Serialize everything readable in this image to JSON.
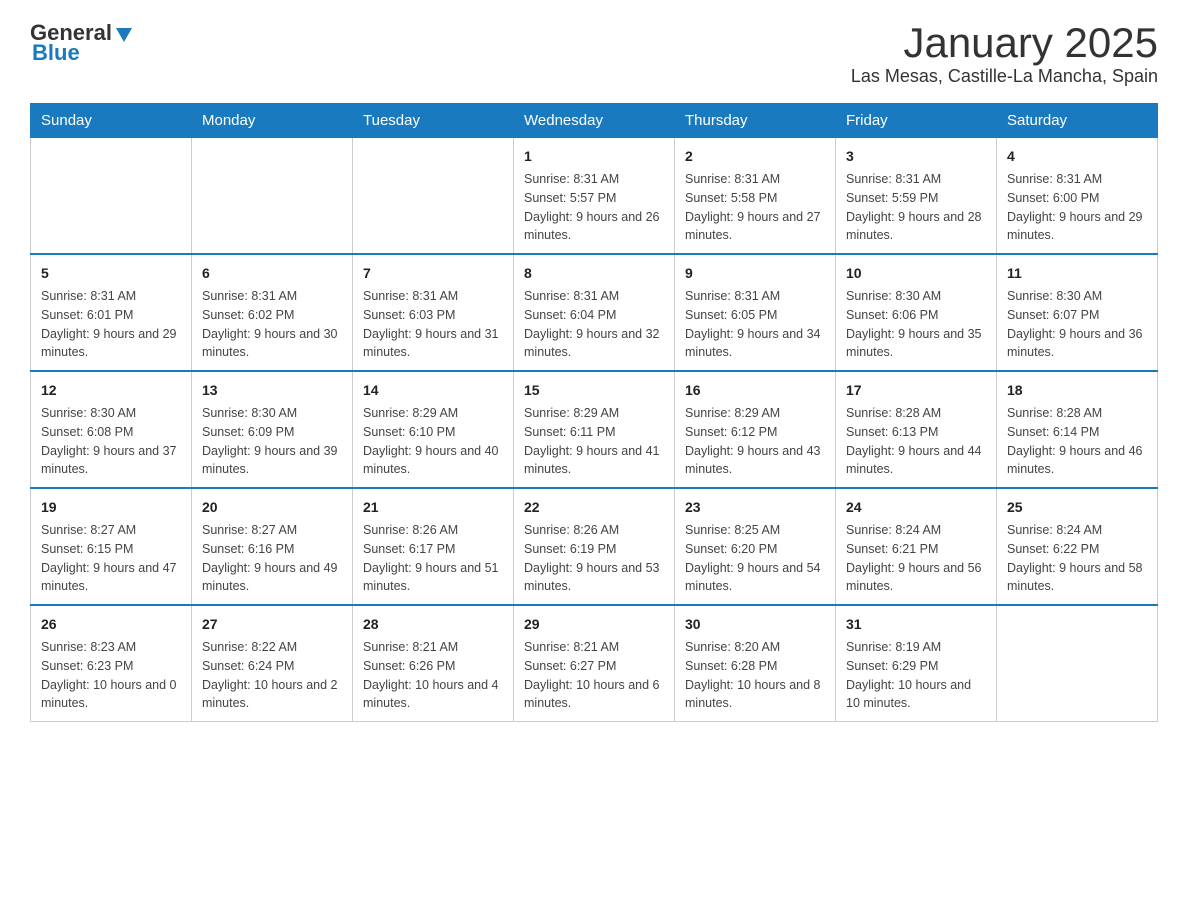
{
  "header": {
    "logo_general": "General",
    "logo_blue": "Blue",
    "title": "January 2025",
    "location": "Las Mesas, Castille-La Mancha, Spain"
  },
  "days_of_week": [
    "Sunday",
    "Monday",
    "Tuesday",
    "Wednesday",
    "Thursday",
    "Friday",
    "Saturday"
  ],
  "weeks": [
    {
      "days": [
        {
          "number": "",
          "info": ""
        },
        {
          "number": "",
          "info": ""
        },
        {
          "number": "",
          "info": ""
        },
        {
          "number": "1",
          "info": "Sunrise: 8:31 AM\nSunset: 5:57 PM\nDaylight: 9 hours and 26 minutes."
        },
        {
          "number": "2",
          "info": "Sunrise: 8:31 AM\nSunset: 5:58 PM\nDaylight: 9 hours and 27 minutes."
        },
        {
          "number": "3",
          "info": "Sunrise: 8:31 AM\nSunset: 5:59 PM\nDaylight: 9 hours and 28 minutes."
        },
        {
          "number": "4",
          "info": "Sunrise: 8:31 AM\nSunset: 6:00 PM\nDaylight: 9 hours and 29 minutes."
        }
      ]
    },
    {
      "days": [
        {
          "number": "5",
          "info": "Sunrise: 8:31 AM\nSunset: 6:01 PM\nDaylight: 9 hours and 29 minutes."
        },
        {
          "number": "6",
          "info": "Sunrise: 8:31 AM\nSunset: 6:02 PM\nDaylight: 9 hours and 30 minutes."
        },
        {
          "number": "7",
          "info": "Sunrise: 8:31 AM\nSunset: 6:03 PM\nDaylight: 9 hours and 31 minutes."
        },
        {
          "number": "8",
          "info": "Sunrise: 8:31 AM\nSunset: 6:04 PM\nDaylight: 9 hours and 32 minutes."
        },
        {
          "number": "9",
          "info": "Sunrise: 8:31 AM\nSunset: 6:05 PM\nDaylight: 9 hours and 34 minutes."
        },
        {
          "number": "10",
          "info": "Sunrise: 8:30 AM\nSunset: 6:06 PM\nDaylight: 9 hours and 35 minutes."
        },
        {
          "number": "11",
          "info": "Sunrise: 8:30 AM\nSunset: 6:07 PM\nDaylight: 9 hours and 36 minutes."
        }
      ]
    },
    {
      "days": [
        {
          "number": "12",
          "info": "Sunrise: 8:30 AM\nSunset: 6:08 PM\nDaylight: 9 hours and 37 minutes."
        },
        {
          "number": "13",
          "info": "Sunrise: 8:30 AM\nSunset: 6:09 PM\nDaylight: 9 hours and 39 minutes."
        },
        {
          "number": "14",
          "info": "Sunrise: 8:29 AM\nSunset: 6:10 PM\nDaylight: 9 hours and 40 minutes."
        },
        {
          "number": "15",
          "info": "Sunrise: 8:29 AM\nSunset: 6:11 PM\nDaylight: 9 hours and 41 minutes."
        },
        {
          "number": "16",
          "info": "Sunrise: 8:29 AM\nSunset: 6:12 PM\nDaylight: 9 hours and 43 minutes."
        },
        {
          "number": "17",
          "info": "Sunrise: 8:28 AM\nSunset: 6:13 PM\nDaylight: 9 hours and 44 minutes."
        },
        {
          "number": "18",
          "info": "Sunrise: 8:28 AM\nSunset: 6:14 PM\nDaylight: 9 hours and 46 minutes."
        }
      ]
    },
    {
      "days": [
        {
          "number": "19",
          "info": "Sunrise: 8:27 AM\nSunset: 6:15 PM\nDaylight: 9 hours and 47 minutes."
        },
        {
          "number": "20",
          "info": "Sunrise: 8:27 AM\nSunset: 6:16 PM\nDaylight: 9 hours and 49 minutes."
        },
        {
          "number": "21",
          "info": "Sunrise: 8:26 AM\nSunset: 6:17 PM\nDaylight: 9 hours and 51 minutes."
        },
        {
          "number": "22",
          "info": "Sunrise: 8:26 AM\nSunset: 6:19 PM\nDaylight: 9 hours and 53 minutes."
        },
        {
          "number": "23",
          "info": "Sunrise: 8:25 AM\nSunset: 6:20 PM\nDaylight: 9 hours and 54 minutes."
        },
        {
          "number": "24",
          "info": "Sunrise: 8:24 AM\nSunset: 6:21 PM\nDaylight: 9 hours and 56 minutes."
        },
        {
          "number": "25",
          "info": "Sunrise: 8:24 AM\nSunset: 6:22 PM\nDaylight: 9 hours and 58 minutes."
        }
      ]
    },
    {
      "days": [
        {
          "number": "26",
          "info": "Sunrise: 8:23 AM\nSunset: 6:23 PM\nDaylight: 10 hours and 0 minutes."
        },
        {
          "number": "27",
          "info": "Sunrise: 8:22 AM\nSunset: 6:24 PM\nDaylight: 10 hours and 2 minutes."
        },
        {
          "number": "28",
          "info": "Sunrise: 8:21 AM\nSunset: 6:26 PM\nDaylight: 10 hours and 4 minutes."
        },
        {
          "number": "29",
          "info": "Sunrise: 8:21 AM\nSunset: 6:27 PM\nDaylight: 10 hours and 6 minutes."
        },
        {
          "number": "30",
          "info": "Sunrise: 8:20 AM\nSunset: 6:28 PM\nDaylight: 10 hours and 8 minutes."
        },
        {
          "number": "31",
          "info": "Sunrise: 8:19 AM\nSunset: 6:29 PM\nDaylight: 10 hours and 10 minutes."
        },
        {
          "number": "",
          "info": ""
        }
      ]
    }
  ]
}
